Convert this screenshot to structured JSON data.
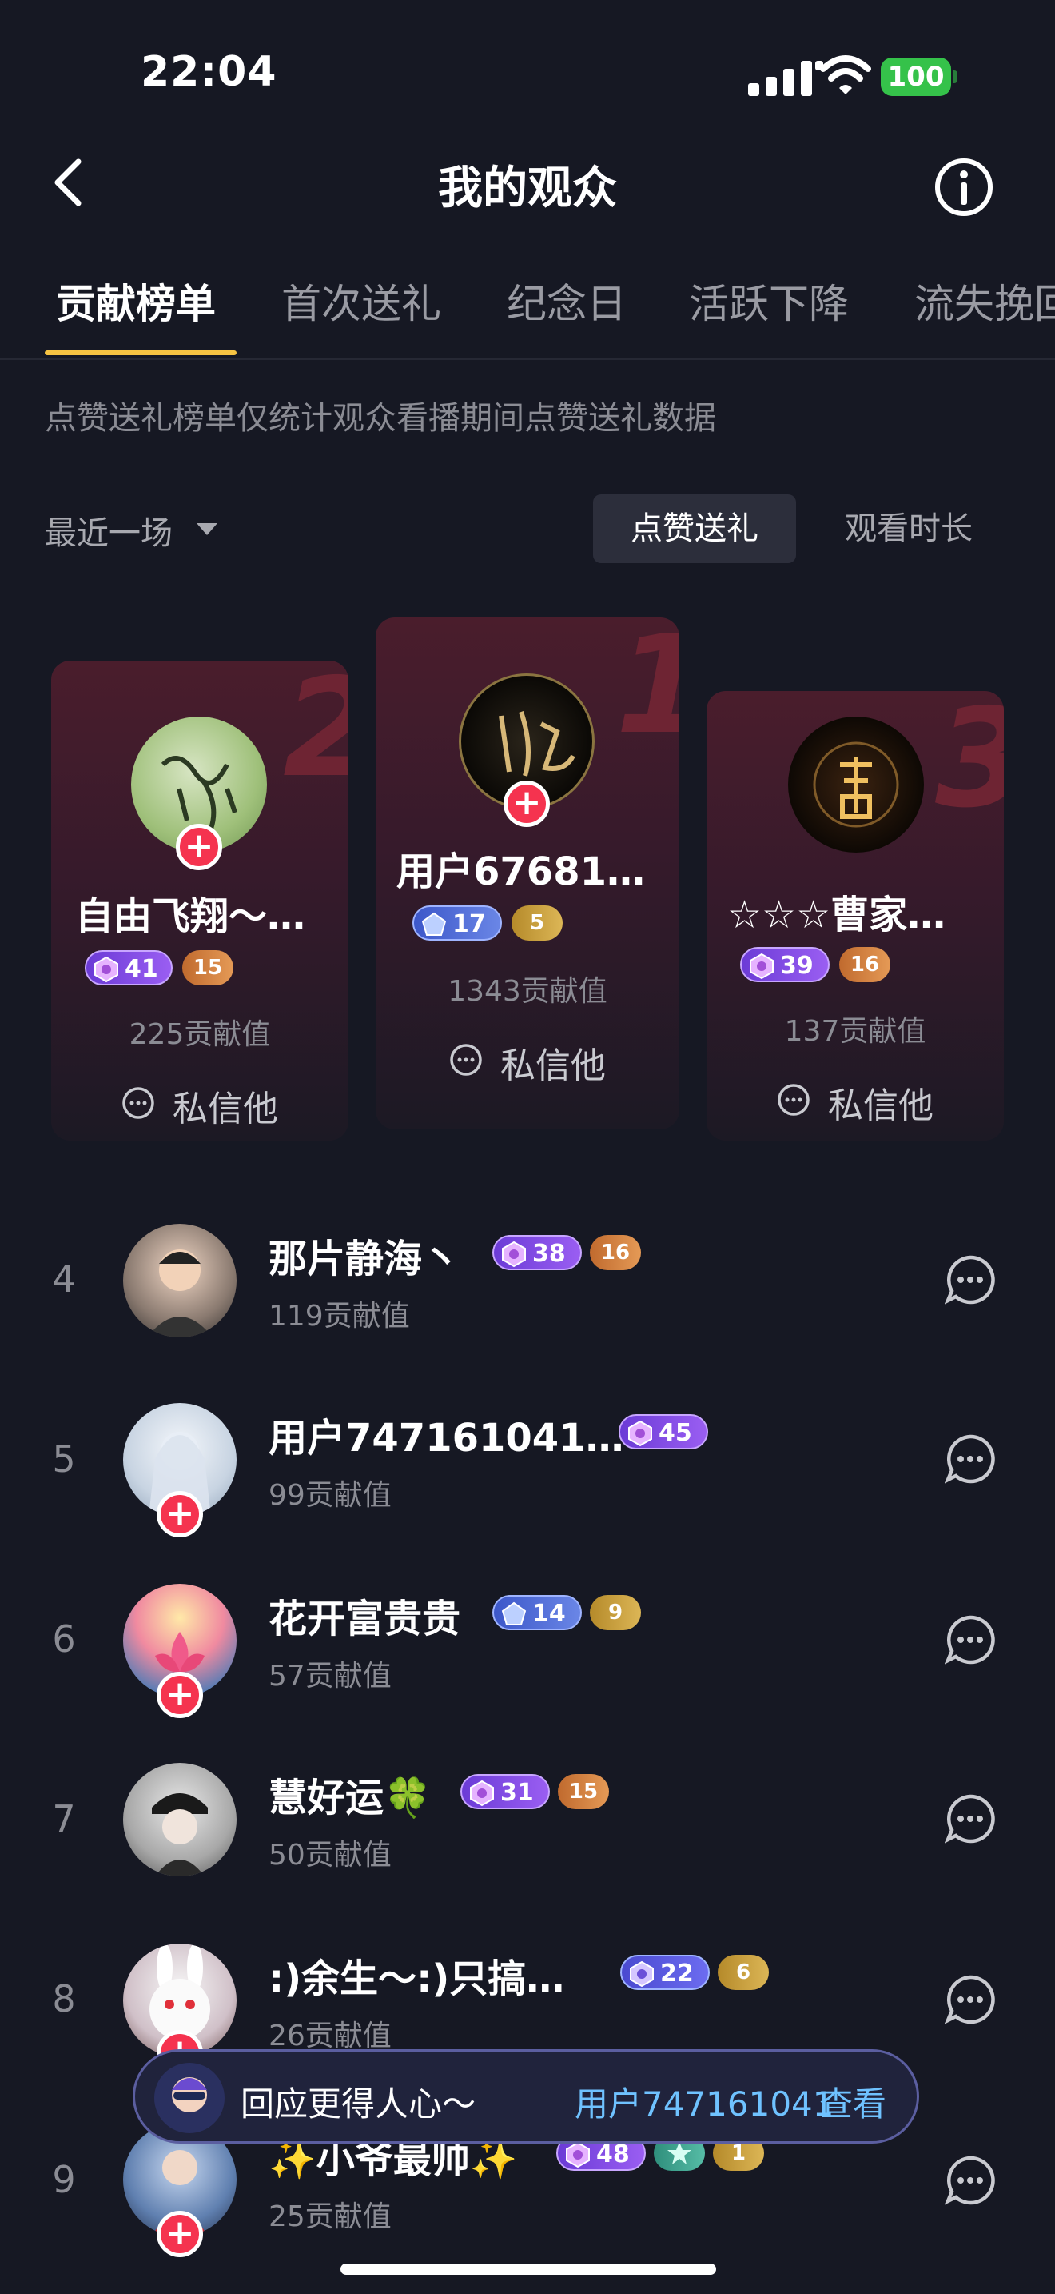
{
  "status_bar": {
    "time": "22:04",
    "battery": "100"
  },
  "header": {
    "title": "我的观众"
  },
  "tabs": [
    "贡献榜单",
    "首次送礼",
    "纪念日",
    "活跃下降",
    "流失挽回"
  ],
  "notice": "点赞送礼榜单仅统计观众看播期间点赞送礼数据",
  "filter": {
    "range": "最近一场",
    "toggle_active": "点赞送礼",
    "toggle_inactive": "观看时长"
  },
  "podium": [
    {
      "rank": "1",
      "name": "用户67681…",
      "level": "17",
      "fan": "5",
      "value": "1343贡献值",
      "message": "私信他"
    },
    {
      "rank": "2",
      "name": "自由飞翔～…",
      "level": "41",
      "fan": "15",
      "value": "225贡献值",
      "message": "私信他"
    },
    {
      "rank": "3",
      "name": "☆☆☆曹家…",
      "level": "39",
      "fan": "16",
      "value": "137贡献值",
      "message": "私信他"
    }
  ],
  "list": [
    {
      "rank": "4",
      "name": "那片静海丶",
      "level": "38",
      "fan": "16",
      "value": "119贡献值"
    },
    {
      "rank": "5",
      "name": "用户747161041…",
      "level": "45",
      "value": "99贡献值"
    },
    {
      "rank": "6",
      "name": "花开富贵贵",
      "level": "14",
      "fan": "9",
      "value": "57贡献值"
    },
    {
      "rank": "7",
      "name": "慧好运🍀",
      "level": "31",
      "fan": "15",
      "value": "50贡献值"
    },
    {
      "rank": "8",
      "name": ":)余生～:)只搞…",
      "level": "22",
      "fan": "6",
      "value": "26贡献值"
    },
    {
      "rank": "9",
      "name": "✨小爷最帅✨",
      "level": "48",
      "fan": "1",
      "value": "25贡献值"
    }
  ],
  "toast": {
    "text": "回应更得人心～",
    "user": "用户747161041",
    "action": "查看"
  },
  "colors": {
    "background": "#161823",
    "accent": "#f6c343",
    "plus": "#f5334f",
    "link": "#6fc2ff"
  }
}
